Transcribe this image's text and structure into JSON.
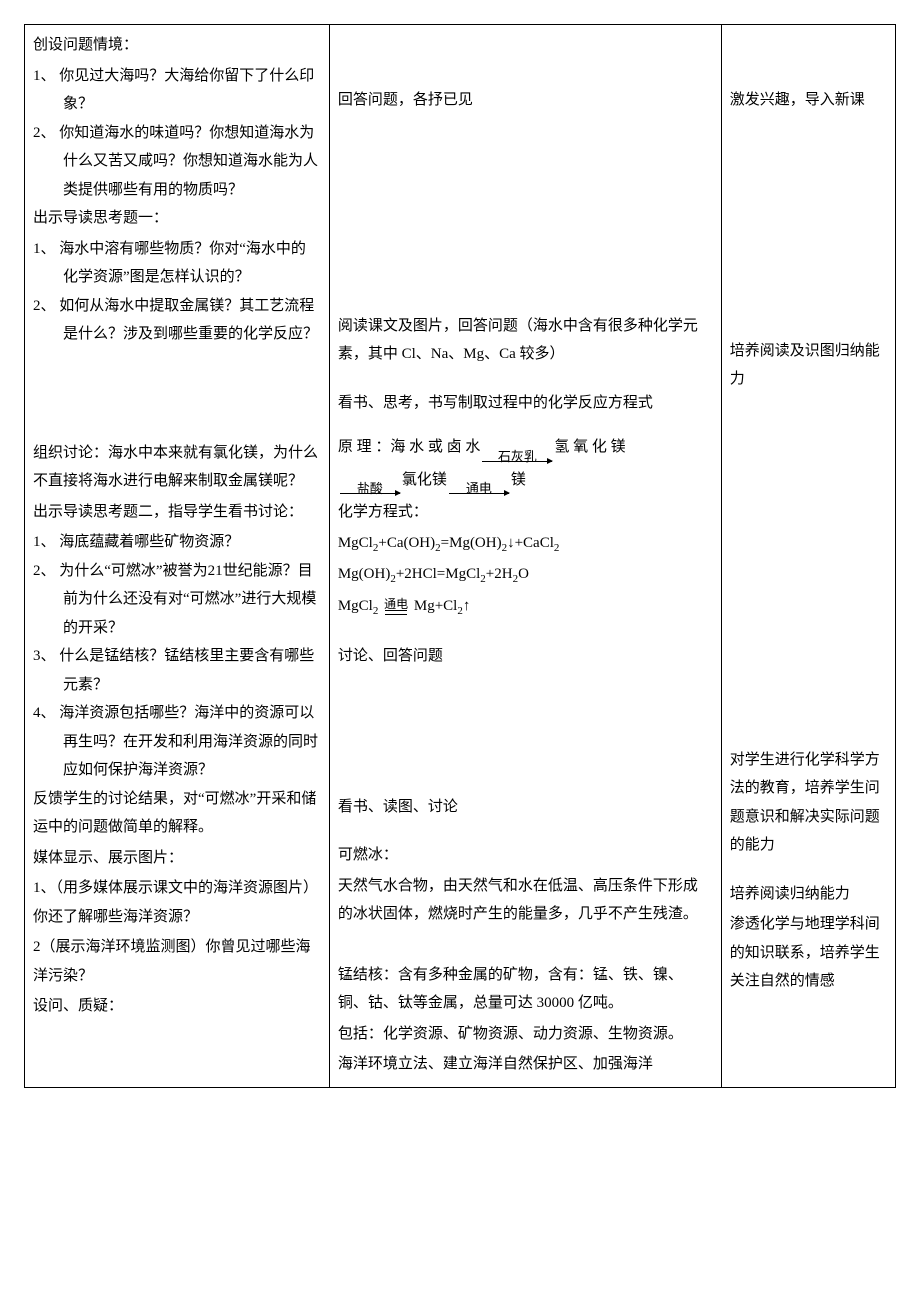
{
  "col1": {
    "situation_title": "创设问题情境：",
    "situation_items": [
      "1、 你见过大海吗？大海给你留下了什么印象？",
      "2、 你知道海水的味道吗？你想知道海水为什么又苦又咸吗？你想知道海水能为人类提供哪些有用的物质吗？"
    ],
    "guide1_title": "出示导读思考题一：",
    "guide1_items": [
      "1、 海水中溶有哪些物质？你对“海水中的化学资源”图是怎样认识的？",
      "2、 如何从海水中提取金属镁？其工艺流程是什么？涉及到哪些重要的化学反应？"
    ],
    "discuss_title": "组织讨论：海水中本来就有氯化镁，为什么不直接将海水进行电解来制取金属镁呢？",
    "guide2_title": "出示导读思考题二，指导学生看书讨论：",
    "guide2_items": [
      "1、 海底蕴藏着哪些矿物资源？",
      "2、 为什么“可燃冰”被誉为21世纪能源？目前为什么还没有对“可燃冰”进行大规模的开采？",
      "3、 什么是锰结核？锰结核里主要含有哪些元素？",
      "4、 海洋资源包括哪些？海洋中的资源可以再生吗？在开发和利用海洋资源的同时应如何保护海洋资源？"
    ],
    "feedback": "反馈学生的讨论结果，对“可燃冰”开采和储运中的问题做简单的解释。",
    "media_title": "媒体显示、展示图片：",
    "media_items": [
      "1、（用多媒体展示课文中的海洋资源图片）你还了解哪些海洋资源？",
      "2（展示海洋环境监测图）你曾见过哪些海洋污染？"
    ],
    "ask": "设问、质疑："
  },
  "col2": {
    "answer1": "回答问题，各抒已见",
    "reading": "阅读课文及图片，回答问题（海水中含有很多种化学元素，其中 Cl、Na、Mg、Ca 较多）",
    "writing": "看书、思考，书写制取过程中的化学反应方程式",
    "principle_label": "原 理 ：",
    "flow_nodes": [
      "海 水 或 卤 水",
      "氢 氧 化 镁",
      "氯化镁",
      "镁"
    ],
    "flow_reagents": [
      "石灰乳",
      "盐酸",
      "通电"
    ],
    "eq_label": "化学方程式：",
    "eq1_parts": [
      "MgCl",
      "2",
      "+Ca(OH)",
      "2",
      "=Mg(OH)",
      "2",
      "↓+CaCl",
      "2"
    ],
    "eq2_parts": [
      "Mg(OH)",
      "2",
      "+2HCl=MgCl",
      "2",
      "+2H",
      "2",
      "O"
    ],
    "eq3_left": "MgCl",
    "eq3_left_sub": "2",
    "eq3_cond": "通电",
    "eq3_right": " Mg+Cl",
    "eq3_right_sub": "2",
    "eq3_tail": "↑",
    "discuss_answer": "讨论、回答问题",
    "read_discuss": "看书、读图、讨论",
    "combustible_label": "可燃冰：",
    "combustible_text": "天然气水合物，由天然气和水在低温、高压条件下形成的冰状固体，燃烧时产生的能量多，几乎不产生残渣。",
    "manganese": "锰结核：含有多种金属的矿物，含有：锰、铁、镍、铜、钴、钛等金属，总量可达 30000 亿吨。",
    "includes": "包括：化学资源、矿物资源、动力资源、生物资源。",
    "law": "海洋环境立法、建立海洋自然保护区、加强海洋"
  },
  "col3": {
    "n1": "激发兴趣，导入新课",
    "n2": "培养阅读及识图归纳能力",
    "n3": "对学生进行化学科学方法的教育，培养学生问题意识和解决实际问题的能力",
    "n4": "培养阅读归纳能力",
    "n5": "渗透化学与地理学科间的知识联系，培养学生关注自然的情感"
  }
}
